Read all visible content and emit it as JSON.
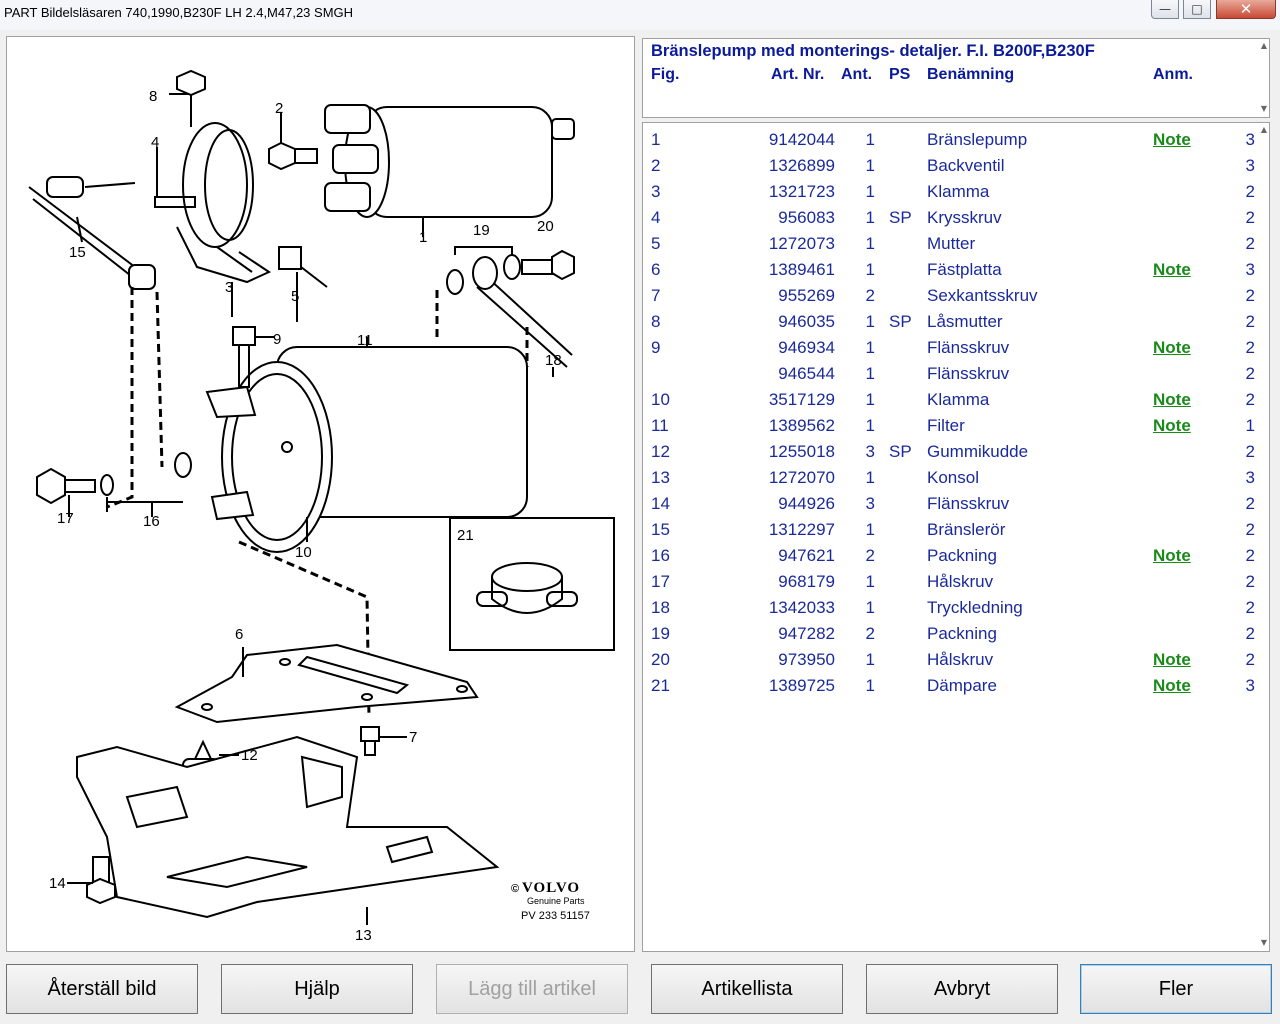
{
  "window": {
    "title": "PART Bildelsläsaren 740,1990,B230F LH 2.4,M47,23 SMGH",
    "minimize": "—",
    "maximize": "□",
    "close": "✕"
  },
  "diagram": {
    "labels": [
      "1",
      "2",
      "3",
      "4",
      "5",
      "6",
      "7",
      "8",
      "9",
      "10",
      "11",
      "12",
      "13",
      "14",
      "15",
      "16",
      "17",
      "18",
      "19",
      "20",
      "21"
    ],
    "brand": "VOLVO",
    "brand_prefix": "©",
    "brand_sub": "Genuine Parts",
    "ref": "PV 233 51157"
  },
  "header": {
    "title": "Bränslepump med monterings- detaljer. F.I. B200F,B230F",
    "cols": {
      "fig": "Fig.",
      "art": "Art. Nr.",
      "ant": "Ant.",
      "ps": "PS",
      "ben": "Benämning",
      "anm": "Anm."
    }
  },
  "rows": [
    {
      "fig": "1",
      "art": "9142044",
      "ant": "1",
      "ps": "",
      "ben": "Bränslepump",
      "note": "Note",
      "x": "3"
    },
    {
      "fig": "2",
      "art": "1326899",
      "ant": "1",
      "ps": "",
      "ben": "Backventil",
      "note": "",
      "x": "3"
    },
    {
      "fig": "3",
      "art": "1321723",
      "ant": "1",
      "ps": "",
      "ben": "Klamma",
      "note": "",
      "x": "2"
    },
    {
      "fig": "4",
      "art": "956083",
      "ant": "1",
      "ps": "SP",
      "ben": "Krysskruv",
      "note": "",
      "x": "2"
    },
    {
      "fig": "5",
      "art": "1272073",
      "ant": "1",
      "ps": "",
      "ben": "Mutter",
      "note": "",
      "x": "2"
    },
    {
      "fig": "6",
      "art": "1389461",
      "ant": "1",
      "ps": "",
      "ben": "Fästplatta",
      "note": "Note",
      "x": "3"
    },
    {
      "fig": "7",
      "art": "955269",
      "ant": "2",
      "ps": "",
      "ben": "Sexkantsskruv",
      "note": "",
      "x": "2"
    },
    {
      "fig": "8",
      "art": "946035",
      "ant": "1",
      "ps": "SP",
      "ben": "Låsmutter",
      "note": "",
      "x": "2"
    },
    {
      "fig": "9",
      "art": "946934",
      "ant": "1",
      "ps": "",
      "ben": "Flänsskruv",
      "note": "Note",
      "x": "2"
    },
    {
      "fig": "",
      "art": "946544",
      "ant": "1",
      "ps": "",
      "ben": "Flänsskruv",
      "note": "",
      "x": "2"
    },
    {
      "fig": "10",
      "art": "3517129",
      "ant": "1",
      "ps": "",
      "ben": "Klamma",
      "note": "Note",
      "x": "2"
    },
    {
      "fig": "11",
      "art": "1389562",
      "ant": "1",
      "ps": "",
      "ben": "Filter",
      "note": "Note",
      "x": "1"
    },
    {
      "fig": "12",
      "art": "1255018",
      "ant": "3",
      "ps": "SP",
      "ben": "Gummikudde",
      "note": "",
      "x": "2"
    },
    {
      "fig": "13",
      "art": "1272070",
      "ant": "1",
      "ps": "",
      "ben": "Konsol",
      "note": "",
      "x": "3"
    },
    {
      "fig": "14",
      "art": "944926",
      "ant": "3",
      "ps": "",
      "ben": "Flänsskruv",
      "note": "",
      "x": "2"
    },
    {
      "fig": "15",
      "art": "1312297",
      "ant": "1",
      "ps": "",
      "ben": "Bränslerör",
      "note": "",
      "x": "2"
    },
    {
      "fig": "16",
      "art": "947621",
      "ant": "2",
      "ps": "",
      "ben": "Packning",
      "note": "Note",
      "x": "2"
    },
    {
      "fig": "17",
      "art": "968179",
      "ant": "1",
      "ps": "",
      "ben": "Hålskruv",
      "note": "",
      "x": "2"
    },
    {
      "fig": "18",
      "art": "1342033",
      "ant": "1",
      "ps": "",
      "ben": "Tryckledning",
      "note": "",
      "x": "2"
    },
    {
      "fig": "19",
      "art": "947282",
      "ant": "2",
      "ps": "",
      "ben": "Packning",
      "note": "",
      "x": "2"
    },
    {
      "fig": "20",
      "art": "973950",
      "ant": "1",
      "ps": "",
      "ben": "Hålskruv",
      "note": "Note",
      "x": "2"
    },
    {
      "fig": "21",
      "art": "1389725",
      "ant": "1",
      "ps": "",
      "ben": "Dämpare",
      "note": "Note",
      "x": "3"
    }
  ],
  "buttons": {
    "reset": "Återställ bild",
    "help": "Hjälp",
    "add": "Lägg till artikel",
    "list": "Artikellista",
    "cancel": "Avbryt",
    "more": "Fler"
  },
  "colors": {
    "text_blue": "#1a2a9c",
    "note_green": "#1a8a1a"
  }
}
